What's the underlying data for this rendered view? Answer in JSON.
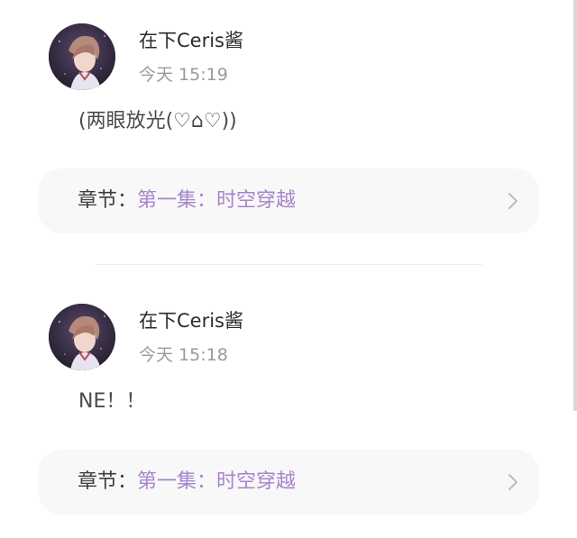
{
  "comments": [
    {
      "username": "在下Ceris酱",
      "time": "今天 15:19",
      "text": "(两眼放光(♡⌂♡))",
      "chapter_prefix": "章节：",
      "chapter_name": "第一集：时空穿越"
    },
    {
      "username": "在下Ceris酱",
      "time": "今天 15:18",
      "text": "NE！！",
      "chapter_prefix": "章节：",
      "chapter_name": "第一集：时空穿越"
    }
  ],
  "colors": {
    "chapter_link": "#a784cc",
    "username": "#2b2b2b",
    "timestamp": "#9a9a9a",
    "card_background": "#f8f8f8"
  },
  "icons": {
    "chevron": "chevron-right-icon",
    "avatar": "user-avatar"
  }
}
